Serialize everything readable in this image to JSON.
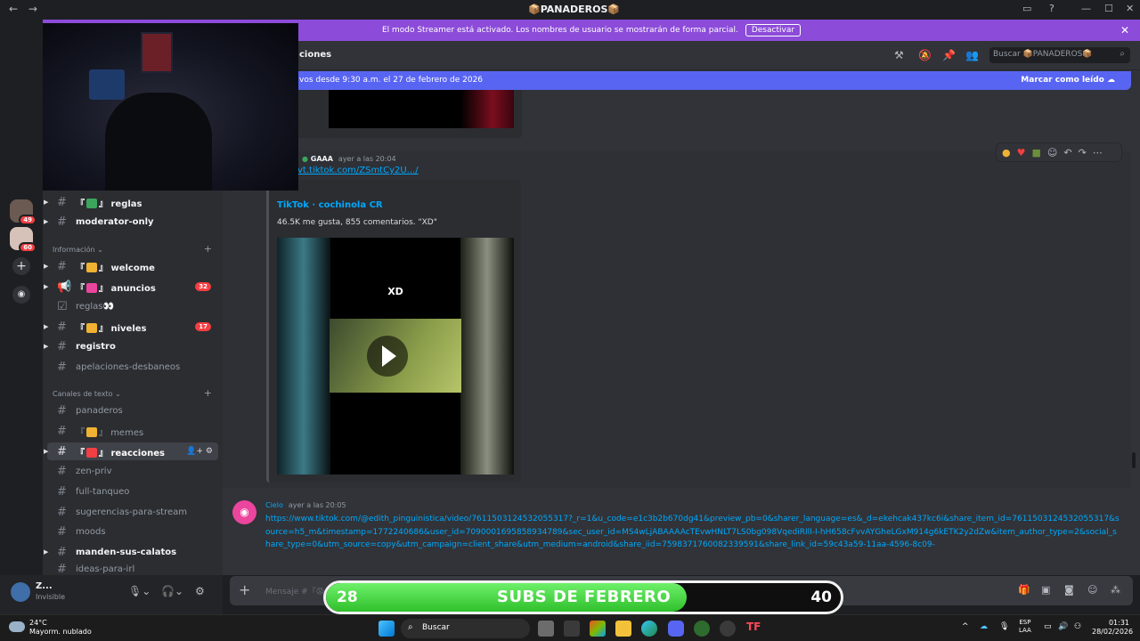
{
  "window": {
    "title": "📦PANADEROS📦",
    "nav_back": "←",
    "nav_forward": "→",
    "controls": [
      "▭",
      "?",
      "—",
      "☐",
      "✕"
    ]
  },
  "banner": {
    "text": "El modo Streamer está activado. Los nombres de usuario se mostrarán de forma parcial.",
    "button": "Desactivar",
    "close": "✕"
  },
  "servers": [
    {
      "badge": "49",
      "color": "#6b5a52"
    },
    {
      "badge": "60",
      "color": "#d6c2b8"
    }
  ],
  "rail_icons": {
    "add": "+",
    "explore": "◉"
  },
  "sidebar": {
    "top_channels": [
      {
        "prefix": "『",
        "emoji_color": "#3ba55d",
        "suffix": "』",
        "name": "reglas",
        "bold": true
      },
      {
        "name": "moderator-only",
        "bold": true
      }
    ],
    "categories": [
      {
        "name": "Información",
        "channels": [
          {
            "name": "welcome",
            "prefix": "『",
            "emoji_color": "#f0b232",
            "suffix": "』",
            "bold": true,
            "icon": "#"
          },
          {
            "name": "anuncios",
            "prefix": "『",
            "emoji_color": "#eb459e",
            "suffix": "』",
            "bold": true,
            "icon": "📢",
            "badge": "32"
          },
          {
            "name": "reglas👀",
            "bold": false,
            "icon": "☑"
          },
          {
            "name": "niveles",
            "prefix": "『",
            "emoji_color": "#f0b232",
            "suffix": "』",
            "bold": true,
            "icon": "#",
            "badge": "17"
          },
          {
            "name": "registro",
            "bold": true,
            "icon": "#"
          },
          {
            "name": "apelaciones-desbaneos",
            "bold": false,
            "icon": "#"
          }
        ]
      },
      {
        "name": "Canales de texto",
        "channels": [
          {
            "name": "panaderos",
            "bold": false,
            "icon": "#"
          },
          {
            "name": "memes",
            "prefix": "『",
            "emoji_color": "#f0b232",
            "suffix": "』",
            "bold": false,
            "icon": "#"
          },
          {
            "name": "reacciones",
            "prefix": "『",
            "emoji_color": "#f23f43",
            "suffix": "』",
            "bold": true,
            "icon": "#",
            "selected": true
          },
          {
            "name": "zen-priv",
            "bold": false,
            "icon": "#"
          },
          {
            "name": "full-tanqueo",
            "bold": false,
            "icon": "#"
          },
          {
            "name": "sugerencias-para-stream",
            "bold": false,
            "icon": "#"
          },
          {
            "name": "moods",
            "bold": false,
            "icon": "#"
          },
          {
            "name": "manden-sus-calatos",
            "bold": true,
            "icon": "#"
          },
          {
            "name": "ideas-para-irl",
            "bold": false,
            "icon": "#"
          }
        ]
      }
    ]
  },
  "user": {
    "name": "Z...",
    "status": "Invisible"
  },
  "chat": {
    "header_name": "ciones",
    "search_placeholder": "Buscar 📦PANADEROS📦",
    "new_messages": "vos desde 9:30 a.m. el 27 de febrero de 2026",
    "mark_read": "Marcar como leído",
    "messages": [
      {
        "author": "GAAA",
        "time": "ayer a las 20:04",
        "link": "vt.tiktok.com/ZSmtCy2U.../",
        "embed": {
          "provider": "TikTok",
          "title": "TikTok · cochinola CR",
          "description": "46.5K me gusta, 855 comentarios. \"XD\"",
          "video_caption": "XD"
        }
      },
      {
        "author": "Cielo",
        "time": "ayer a las 20:05",
        "link": "https://www.tiktok.com/@edith_pinguinistica/video/7611503124532055317?_r=1&u_code=e1c3b2b670dg41&preview_pb=0&sharer_language=es&_d=ekehcak437kc6i&share_item_id=7611503124532055317&source=h5_m&timestamp=1772240686&user_id=7090001695858934789&sec_user_id=MS4wLjABAAAAcTEvwHNLT7LS0bg098VqediRIlI-I-hH658cFvvAYGheLGxM914g6kETK2y2dZw&item_author_type=2&social_share_type=0&utm_source=copy&utm_campaign=client_share&utm_medium=android&share_iid=7598371760082339591&share_link_id=59c43a59-11aa-4596-8c09-"
      }
    ],
    "composer_placeholder": "Mensaje #『😡』reacciones"
  },
  "subs": {
    "current": "28",
    "label": "SUBS DE FEBRERO",
    "goal": "40",
    "progress": 0.7
  },
  "taskbar": {
    "weather_temp": "24°C",
    "weather_desc": "Mayorm. nublado",
    "search": "Buscar",
    "lang_top": "ESP",
    "lang_bottom": "LAA",
    "time": "01:31",
    "date": "28/02/2026"
  }
}
